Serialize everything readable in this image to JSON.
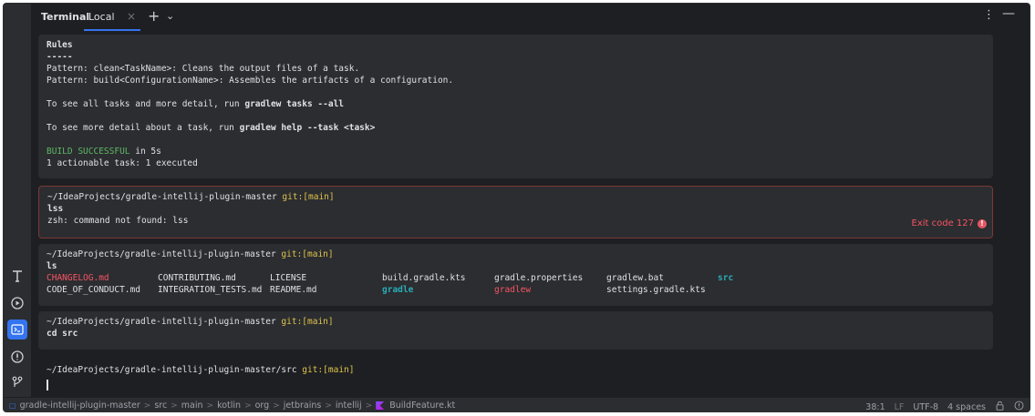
{
  "tabbar": {
    "title": "Terminal",
    "tab_label": "Local",
    "close_glyph": "×",
    "add_glyph": "+",
    "dropdown_glyph": "⌄",
    "more_glyph": "⋮",
    "minimize_glyph": "—"
  },
  "output_block": {
    "lines": [
      "Rules",
      "-----",
      "Pattern: clean<TaskName>: Cleans the output files of a task.",
      "Pattern: build<ConfigurationName>: Assembles the artifacts of a configuration.",
      "",
      "To see all tasks and more detail, run ",
      "gradlew tasks --all",
      "",
      "To see more detail about a task, run ",
      "gradlew help --task <task>",
      "",
      "BUILD SUCCESSFUL",
      " in 5s",
      "1 actionable task: 1 executed"
    ]
  },
  "prompt": {
    "path": "~/IdeaProjects/gradle-intellij-plugin-master",
    "path_src": "~/IdeaProjects/gradle-intellij-plugin-master/src",
    "git": "git:[main]"
  },
  "error_block": {
    "command": "lss",
    "output": "zsh: command not found: lss",
    "exit_label": "Exit code 127",
    "exit_icon": "!"
  },
  "ls_block": {
    "command": "ls",
    "row1": [
      "CHANGELOG.md",
      "CONTRIBUTING.md",
      "LICENSE",
      "build.gradle.kts",
      "gradle.properties",
      "gradlew.bat",
      "src"
    ],
    "row2": [
      "CODE_OF_CONDUCT.md",
      "INTEGRATION_TESTS.md",
      "README.md",
      "gradle",
      "gradlew",
      "settings.gradle.kts"
    ]
  },
  "cd_block": {
    "command": "cd src"
  },
  "toolstrip": [
    "terminal-font-icon",
    "run-icon",
    "terminal-icon",
    "problems-icon",
    "git-icon"
  ],
  "statusbar": {
    "crumbs": [
      "gradle-intellij-plugin-master",
      "src",
      "main",
      "kotlin",
      "org",
      "jetbrains",
      "intellij",
      "BuildFeature.kt"
    ],
    "position": "38:1",
    "line_sep": "LF",
    "encoding": "UTF-8",
    "indent": "4 spaces"
  },
  "colors": {
    "accent": "#3574f0",
    "success": "#5fb865",
    "error": "#f75464",
    "git": "#e0c34c",
    "dir": "#2aacb8"
  }
}
